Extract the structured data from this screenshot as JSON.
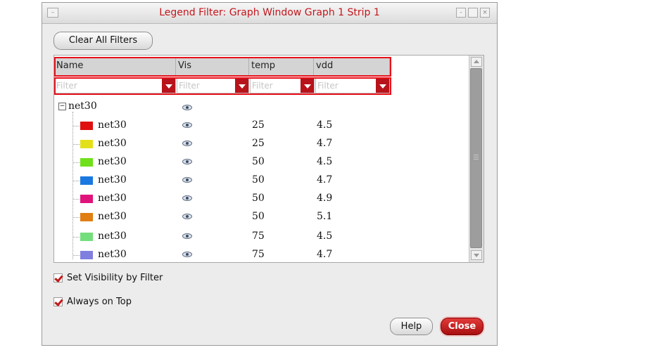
{
  "window": {
    "title": "Legend Filter: Graph Window Graph 1 Strip 1",
    "menu_icon": "menu-icon",
    "minimize_icon": "minimize-icon",
    "maximize_icon": "maximize-icon",
    "close_icon": "close-x-icon"
  },
  "toolbar": {
    "clear_all_label": "Clear All Filters"
  },
  "table": {
    "columns": [
      "Name",
      "Vis",
      "temp",
      "vdd"
    ],
    "filter_placeholder": "Filter",
    "root": {
      "name": "net30",
      "expanded": true
    },
    "rows": [
      {
        "name": "net30",
        "color": "#e01010",
        "temp": "25",
        "vdd": "4.5"
      },
      {
        "name": "net30",
        "color": "#e3e01a",
        "temp": "25",
        "vdd": "4.7"
      },
      {
        "name": "net30",
        "color": "#6fe01a",
        "temp": "50",
        "vdd": "4.5"
      },
      {
        "name": "net30",
        "color": "#1a78e0",
        "temp": "50",
        "vdd": "4.7"
      },
      {
        "name": "net30",
        "color": "#e0137a",
        "temp": "50",
        "vdd": "4.9"
      },
      {
        "name": "net30",
        "color": "#e07e13",
        "temp": "50",
        "vdd": "5.1"
      },
      {
        "name": "net30",
        "color": "#74de7c",
        "temp": "75",
        "vdd": "4.5"
      },
      {
        "name": "net30",
        "color": "#7f7fe0",
        "temp": "75",
        "vdd": "4.7"
      }
    ]
  },
  "options": {
    "set_visibility_label": "Set Visibility by Filter",
    "set_visibility_checked": true,
    "always_on_top_label": "Always on Top",
    "always_on_top_checked": true
  },
  "footer": {
    "help_label": "Help",
    "close_label": "Close"
  },
  "colors": {
    "accent": "#c4161c",
    "highlight": "#e8101a"
  }
}
